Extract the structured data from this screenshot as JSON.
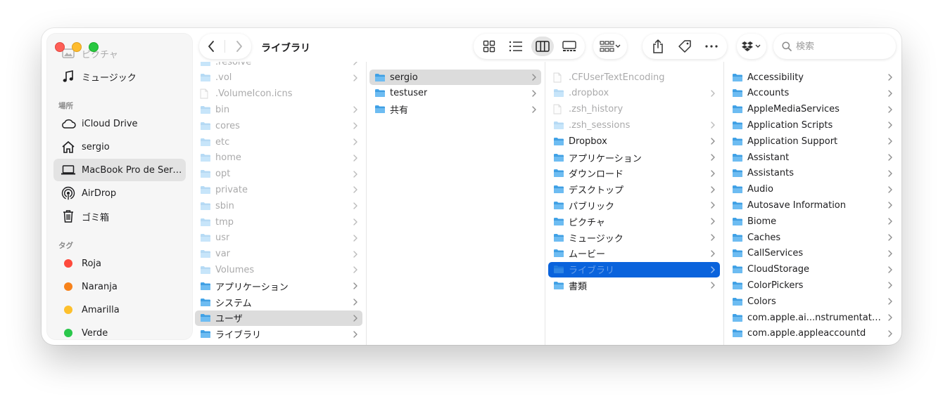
{
  "window": {
    "title": "ライブラリ"
  },
  "sidebar": {
    "top_faded_item": "ピクチャ",
    "items": [
      {
        "label": "ミュージック",
        "icon": "music-note-icon"
      }
    ],
    "locations_header": "場所",
    "locations": [
      {
        "label": "iCloud Drive",
        "icon": "cloud-icon"
      },
      {
        "label": "sergio",
        "icon": "house-icon"
      },
      {
        "label": "MacBook Pro de Sergio",
        "icon": "laptop-icon"
      },
      {
        "label": "AirDrop",
        "icon": "airdrop-icon"
      },
      {
        "label": "ゴミ箱",
        "icon": "trash-icon"
      }
    ],
    "tags_header": "タグ",
    "tags": [
      {
        "label": "Roja",
        "color": "#fe4a3c"
      },
      {
        "label": "Naranja",
        "color": "#f7821b"
      },
      {
        "label": "Amarilla",
        "color": "#fdc02c"
      },
      {
        "label": "Verde",
        "color": "#2ac74b"
      }
    ]
  },
  "search": {
    "placeholder": "検索"
  },
  "colors": {
    "selection_blue": "#0a63dc",
    "folder_blue": "#41a3e8"
  },
  "columns": {
    "root": [
      {
        "name": ".resolve",
        "kind": "folder",
        "faded": true,
        "chevron": true
      },
      {
        "name": ".vol",
        "kind": "folder",
        "faded": true,
        "chevron": true
      },
      {
        "name": ".VolumeIcon.icns",
        "kind": "file",
        "faded": true,
        "chevron": false
      },
      {
        "name": "bin",
        "kind": "folder",
        "faded": true,
        "chevron": true
      },
      {
        "name": "cores",
        "kind": "folder",
        "faded": true,
        "chevron": true
      },
      {
        "name": "etc",
        "kind": "folder",
        "faded": true,
        "chevron": true
      },
      {
        "name": "home",
        "kind": "folder",
        "faded": true,
        "chevron": true
      },
      {
        "name": "opt",
        "kind": "folder",
        "faded": true,
        "chevron": true
      },
      {
        "name": "private",
        "kind": "folder",
        "faded": true,
        "chevron": true
      },
      {
        "name": "sbin",
        "kind": "folder",
        "faded": true,
        "chevron": true
      },
      {
        "name": "tmp",
        "kind": "folder",
        "faded": true,
        "chevron": true
      },
      {
        "name": "usr",
        "kind": "folder",
        "faded": true,
        "chevron": true
      },
      {
        "name": "var",
        "kind": "folder",
        "faded": true,
        "chevron": true
      },
      {
        "name": "Volumes",
        "kind": "folder",
        "faded": true,
        "chevron": true
      },
      {
        "name": "アプリケーション",
        "kind": "folder",
        "faded": false,
        "chevron": true
      },
      {
        "name": "システム",
        "kind": "folder",
        "faded": false,
        "chevron": true
      },
      {
        "name": "ユーザ",
        "kind": "folder",
        "faded": false,
        "chevron": true,
        "selected": "grey"
      },
      {
        "name": "ライブラリ",
        "kind": "folder",
        "faded": false,
        "chevron": true
      }
    ],
    "users": [
      {
        "name": "sergio",
        "kind": "folder",
        "faded": false,
        "chevron": true,
        "selected": "grey"
      },
      {
        "name": "testuser",
        "kind": "folder",
        "faded": false,
        "chevron": true
      },
      {
        "name": "共有",
        "kind": "folder",
        "faded": false,
        "chevron": true
      }
    ],
    "home": [
      {
        "name": ".CFUserTextEncoding",
        "kind": "file",
        "faded": true,
        "chevron": false
      },
      {
        "name": ".dropbox",
        "kind": "folder",
        "faded": true,
        "chevron": true
      },
      {
        "name": ".zsh_history",
        "kind": "file",
        "faded": true,
        "chevron": false
      },
      {
        "name": ".zsh_sessions",
        "kind": "folder",
        "faded": true,
        "chevron": true
      },
      {
        "name": "Dropbox",
        "kind": "folder",
        "faded": false,
        "chevron": true
      },
      {
        "name": "アプリケーション",
        "kind": "folder",
        "faded": false,
        "chevron": true
      },
      {
        "name": "ダウンロード",
        "kind": "folder",
        "faded": false,
        "chevron": true
      },
      {
        "name": "デスクトップ",
        "kind": "folder",
        "faded": false,
        "chevron": true
      },
      {
        "name": "パブリック",
        "kind": "folder",
        "faded": false,
        "chevron": true
      },
      {
        "name": "ピクチャ",
        "kind": "folder",
        "faded": false,
        "chevron": true
      },
      {
        "name": "ミュージック",
        "kind": "folder",
        "faded": false,
        "chevron": true
      },
      {
        "name": "ムービー",
        "kind": "folder",
        "faded": false,
        "chevron": true
      },
      {
        "name": "ライブラリ",
        "kind": "folder",
        "faded": true,
        "chevron": true,
        "selected": "blue"
      },
      {
        "name": "書類",
        "kind": "folder",
        "faded": false,
        "chevron": true
      }
    ],
    "library": [
      {
        "name": "Accessibility",
        "kind": "folder",
        "faded": false,
        "chevron": true
      },
      {
        "name": "Accounts",
        "kind": "folder",
        "faded": false,
        "chevron": true
      },
      {
        "name": "AppleMediaServices",
        "kind": "folder",
        "faded": false,
        "chevron": true
      },
      {
        "name": "Application Scripts",
        "kind": "folder",
        "faded": false,
        "chevron": true
      },
      {
        "name": "Application Support",
        "kind": "folder",
        "faded": false,
        "chevron": true
      },
      {
        "name": "Assistant",
        "kind": "folder",
        "faded": false,
        "chevron": true
      },
      {
        "name": "Assistants",
        "kind": "folder",
        "faded": false,
        "chevron": true
      },
      {
        "name": "Audio",
        "kind": "folder",
        "faded": false,
        "chevron": true
      },
      {
        "name": "Autosave Information",
        "kind": "folder",
        "faded": false,
        "chevron": true
      },
      {
        "name": "Biome",
        "kind": "folder",
        "faded": false,
        "chevron": true
      },
      {
        "name": "Caches",
        "kind": "folder",
        "faded": false,
        "chevron": true
      },
      {
        "name": "CallServices",
        "kind": "folder",
        "faded": false,
        "chevron": true
      },
      {
        "name": "CloudStorage",
        "kind": "folder",
        "faded": false,
        "chevron": true
      },
      {
        "name": "ColorPickers",
        "kind": "folder",
        "faded": false,
        "chevron": true
      },
      {
        "name": "Colors",
        "kind": "folder",
        "faded": false,
        "chevron": true
      },
      {
        "name": "com.apple.ai...nstrumentation",
        "kind": "folder",
        "faded": false,
        "chevron": true
      },
      {
        "name": "com.apple.appleaccountd",
        "kind": "folder",
        "faded": false,
        "chevron": true
      }
    ]
  }
}
